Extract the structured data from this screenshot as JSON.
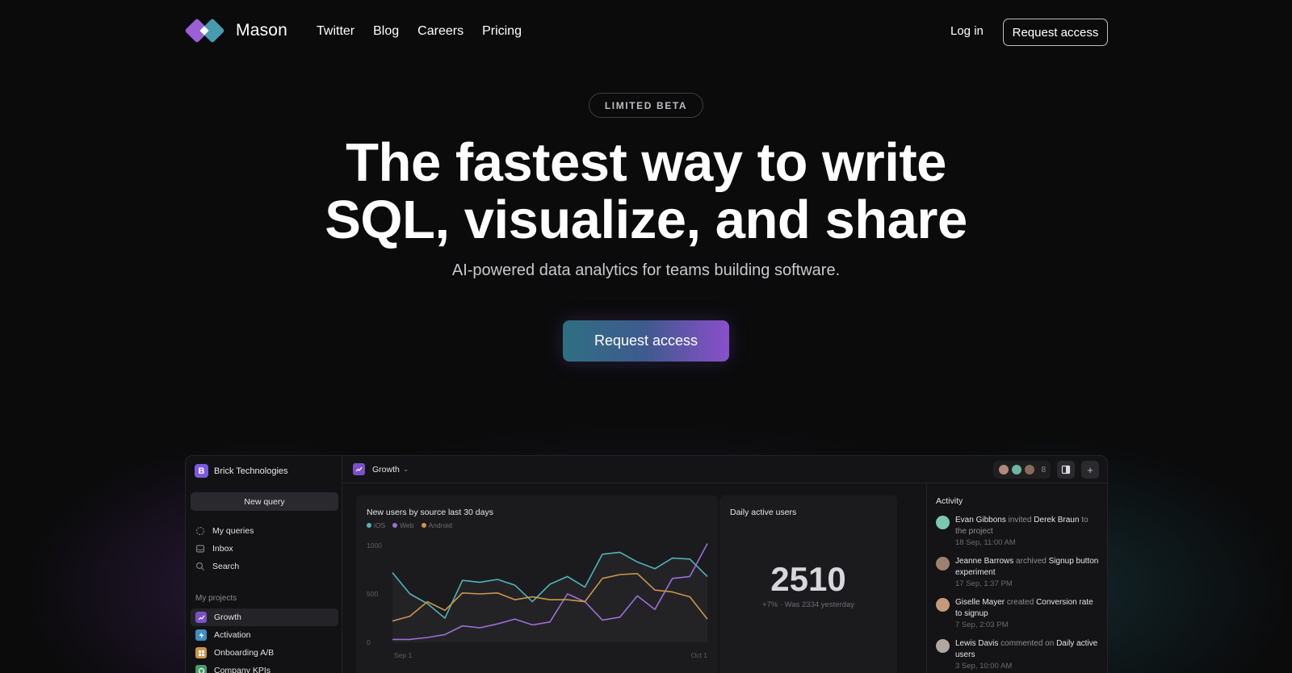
{
  "nav": {
    "logo_text": "Mason",
    "links": [
      "Twitter",
      "Blog",
      "Careers",
      "Pricing"
    ],
    "login_label": "Log in",
    "cta_label": "Request access"
  },
  "hero": {
    "badge": "LIMITED BETA",
    "headline_line1": "The fastest way to write",
    "headline_line2": "SQL, visualize, and share",
    "subtitle": "AI-powered data analytics for teams building software.",
    "cta_label": "Request access"
  },
  "app": {
    "workspace_name": "Brick Technologies",
    "workspace_initial": "B",
    "new_query_label": "New query",
    "nav_items": [
      {
        "label": "My queries",
        "icon": "queries-icon"
      },
      {
        "label": "Inbox",
        "icon": "inbox-icon"
      },
      {
        "label": "Search",
        "icon": "search-icon"
      }
    ],
    "projects_heading": "My projects",
    "projects": [
      {
        "label": "Growth",
        "color": "#7a4fc7",
        "active": true
      },
      {
        "label": "Activation",
        "color": "#3f8fc4",
        "active": false
      },
      {
        "label": "Onboarding A/B",
        "color": "#c9974a",
        "active": false
      },
      {
        "label": "Company KPIs",
        "color": "#4a9b6a",
        "active": false
      }
    ],
    "breadcrumb": "Growth",
    "member_count": "8",
    "chart_card": {
      "title": "New users by source last 30 days",
      "legend": [
        "iOS",
        "Web",
        "Android"
      ]
    },
    "dau_card": {
      "title": "Daily active users",
      "value": "2510",
      "subtitle": "+7% · Was 2334 yesterday"
    },
    "activity": {
      "heading": "Activity",
      "items": [
        {
          "actor": "Evan Gibbons",
          "verb": "invited",
          "object": "Derek Braun",
          "rest": "to the project",
          "time": "18 Sep, 11:00 AM"
        },
        {
          "actor": "Jeanne Barrows",
          "verb": "archived",
          "object": "Signup button experiment",
          "rest": "",
          "time": "17 Sep, 1:37 PM"
        },
        {
          "actor": "Giselle Mayer",
          "verb": "created",
          "object": "Conversion rate to signup",
          "rest": "",
          "time": "7 Sep, 2:03 PM"
        },
        {
          "actor": "Lewis Davis",
          "verb": "commented on",
          "object": "Daily active users",
          "rest": "",
          "time": "3 Sep, 10:00 AM"
        }
      ]
    }
  },
  "colors": {
    "ios": "#4fb3b8",
    "web": "#9a6fd6",
    "android": "#c9974a",
    "cta_gradient_start": "#2f6f82",
    "cta_gradient_end": "#8a4fcb"
  },
  "chart_data": {
    "type": "line",
    "title": "New users by source last 30 days",
    "x_start_label": "Sep 1",
    "x_end_label": "Oct 1",
    "y_ticks": [
      0,
      500,
      1000
    ],
    "ylim": [
      0,
      1000
    ],
    "series": [
      {
        "name": "iOS",
        "values": [
          720,
          500,
          400,
          250,
          640,
          620,
          650,
          590,
          420,
          600,
          680,
          570,
          910,
          930,
          830,
          760,
          870,
          860,
          680
        ]
      },
      {
        "name": "Web",
        "values": [
          30,
          30,
          50,
          80,
          170,
          150,
          190,
          240,
          180,
          210,
          500,
          420,
          230,
          260,
          480,
          340,
          660,
          680,
          1020
        ]
      },
      {
        "name": "Android",
        "values": [
          220,
          270,
          420,
          330,
          510,
          500,
          510,
          440,
          470,
          440,
          440,
          420,
          660,
          700,
          710,
          540,
          520,
          470,
          240
        ]
      }
    ]
  }
}
